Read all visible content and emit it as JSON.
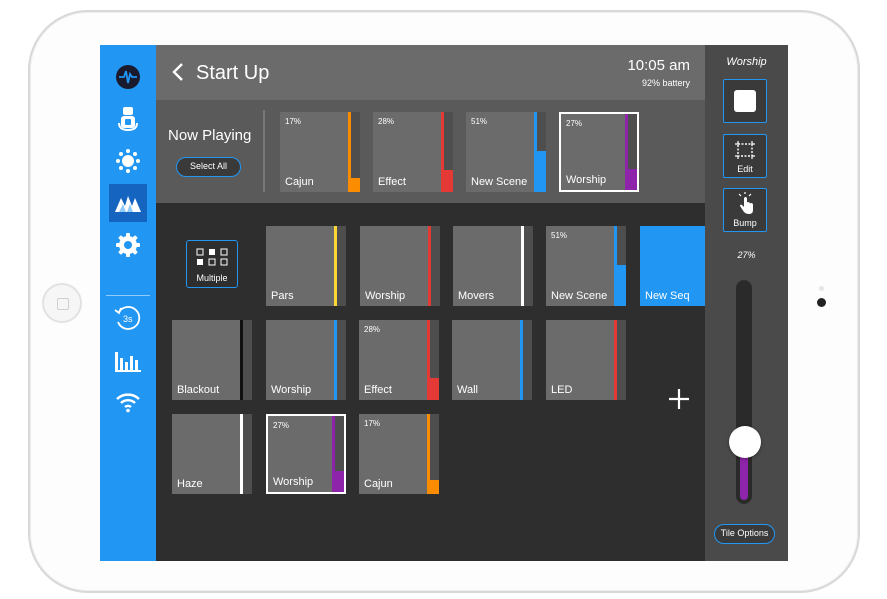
{
  "header": {
    "title": "Start Up",
    "time": "10:05 am",
    "battery": "92% battery"
  },
  "sidebar": {
    "items": [
      {
        "icon": "waveform-icon"
      },
      {
        "icon": "spotlight-icon"
      },
      {
        "icon": "sun-icon"
      },
      {
        "icon": "mountains-icon",
        "active": true
      },
      {
        "icon": "gear-icon"
      },
      {
        "icon": "timer-3s-icon",
        "label": "3s"
      },
      {
        "icon": "equalizer-icon"
      },
      {
        "icon": "wifi-icon"
      }
    ]
  },
  "now_playing": {
    "label": "Now Playing",
    "select_all": "Select All",
    "tiles": [
      {
        "name": "Cajun",
        "pct": "17%",
        "color": "#fb8c00",
        "level": 0.17,
        "selected": false
      },
      {
        "name": "Effect",
        "pct": "28%",
        "color": "#e53935",
        "level": 0.28,
        "selected": false
      },
      {
        "name": "New Scene",
        "pct": "51%",
        "color": "#2196f3",
        "level": 0.51,
        "selected": false
      },
      {
        "name": "Worship",
        "pct": "27%",
        "color": "#8e24aa",
        "level": 0.27,
        "selected": true
      }
    ]
  },
  "grid": {
    "multiple_label": "Multiple",
    "rows": [
      [
        {
          "name": "Pars",
          "pct": "",
          "color": "#fdd835",
          "level": 0
        },
        {
          "name": "Worship",
          "pct": "",
          "color": "#e53935",
          "level": 0
        },
        {
          "name": "Movers",
          "pct": "",
          "color": "#ffffff",
          "level": 0
        },
        {
          "name": "New Scene",
          "pct": "51%",
          "color": "#2196f3",
          "level": 0.51
        },
        {
          "name": "New Seq",
          "pct": "",
          "color": "#2196f3",
          "level": 0,
          "highlight": true
        }
      ],
      [
        {
          "name": "Blackout",
          "pct": "",
          "color": "#111111",
          "level": 0
        },
        {
          "name": "Worship",
          "pct": "",
          "color": "#2196f3",
          "level": 0
        },
        {
          "name": "Effect",
          "pct": "28%",
          "color": "#e53935",
          "level": 0.28
        },
        {
          "name": "Wall",
          "pct": "",
          "color": "#2196f3",
          "level": 0
        },
        {
          "name": "LED",
          "pct": "",
          "color": "#e53935",
          "level": 0
        }
      ],
      [
        {
          "name": "Haze",
          "pct": "",
          "color": "#ffffff",
          "level": 0
        },
        {
          "name": "Worship",
          "pct": "27%",
          "color": "#8e24aa",
          "level": 0.27,
          "selected": true
        },
        {
          "name": "Cajun",
          "pct": "17%",
          "color": "#fb8c00",
          "level": 0.17
        }
      ]
    ]
  },
  "right_panel": {
    "title": "Worship",
    "edit_label": "Edit",
    "bump_label": "Bump",
    "level_pct": "27%",
    "level": 0.27,
    "tile_options": "Tile Options"
  }
}
